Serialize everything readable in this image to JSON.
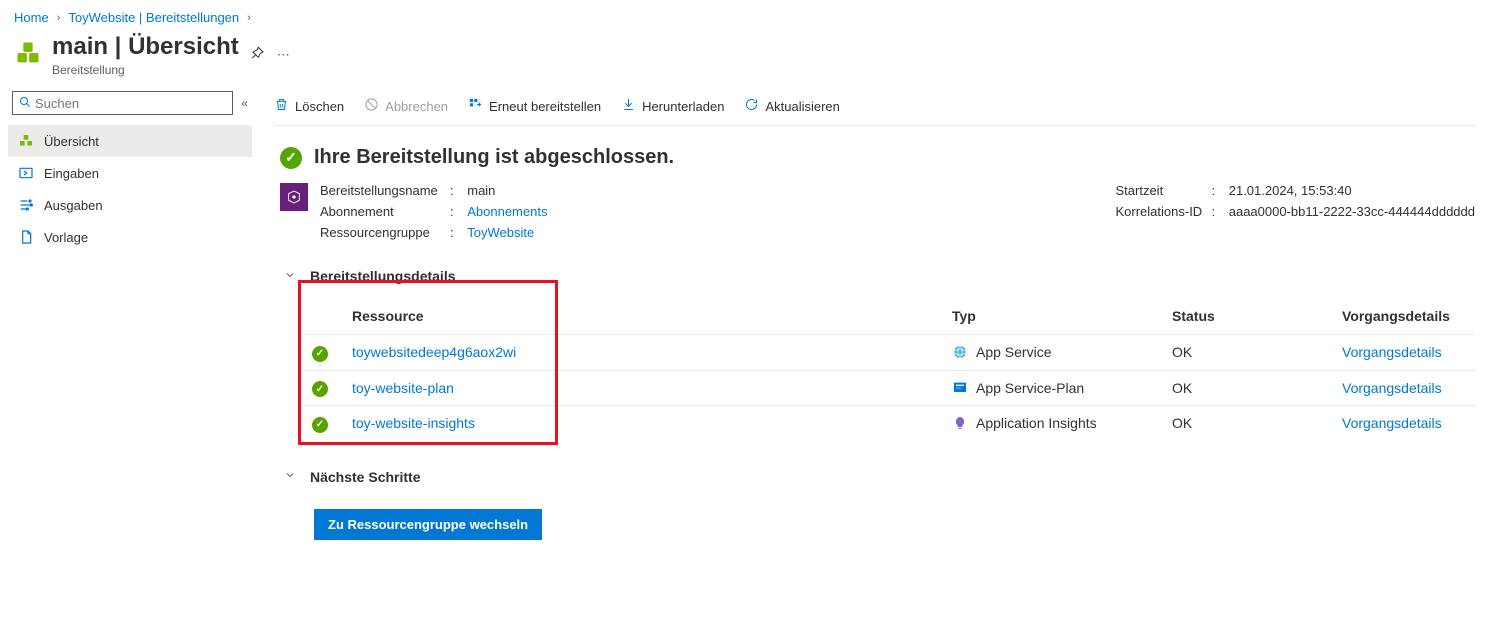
{
  "breadcrumb": {
    "home": "Home",
    "deploy": "ToyWebsite | Bereitstellungen"
  },
  "header": {
    "title": "main | Übersicht",
    "subtitle": "Bereitstellung"
  },
  "sidebar": {
    "search_placeholder": "Suchen",
    "items": [
      {
        "label": "Übersicht"
      },
      {
        "label": "Eingaben"
      },
      {
        "label": "Ausgaben"
      },
      {
        "label": "Vorlage"
      }
    ]
  },
  "toolbar": {
    "delete": "Löschen",
    "cancel": "Abbrechen",
    "redeploy": "Erneut bereitstellen",
    "download": "Herunterladen",
    "refresh": "Aktualisieren"
  },
  "status": {
    "headline": "Ihre Bereitstellung ist abgeschlossen."
  },
  "meta": {
    "left": {
      "deployment_name_label": "Bereitstellungsname",
      "deployment_name_value": "main",
      "subscription_label": "Abonnement",
      "subscription_value": "Abonnements",
      "rg_label": "Ressourcengruppe",
      "rg_value": "ToyWebsite"
    },
    "right": {
      "starttime_label": "Startzeit",
      "starttime_value": "21.01.2024, 15:53:40",
      "corr_label": "Korrelations-ID",
      "corr_value": "aaaa0000-bb11-2222-33cc-444444dddddd"
    }
  },
  "sections": {
    "details": "Bereitstellungsdetails",
    "next": "Nächste Schritte"
  },
  "table": {
    "headers": {
      "resource": "Ressource",
      "type": "Typ",
      "status": "Status",
      "opdetails": "Vorgangsdetails"
    },
    "opdetails_link": "Vorgangsdetails",
    "rows": [
      {
        "resource": "toywebsitedeep4g6aox2wi",
        "type": "App Service",
        "status": "OK",
        "icon_bg": "#0078d4"
      },
      {
        "resource": "toy-website-plan",
        "type": "App Service-Plan",
        "status": "OK",
        "icon_bg": "#0078d4"
      },
      {
        "resource": "toy-website-insights",
        "type": "Application Insights",
        "status": "OK",
        "icon_bg": "#8661c5"
      }
    ]
  },
  "button": {
    "to_rg": "Zu Ressourcengruppe wechseln"
  }
}
